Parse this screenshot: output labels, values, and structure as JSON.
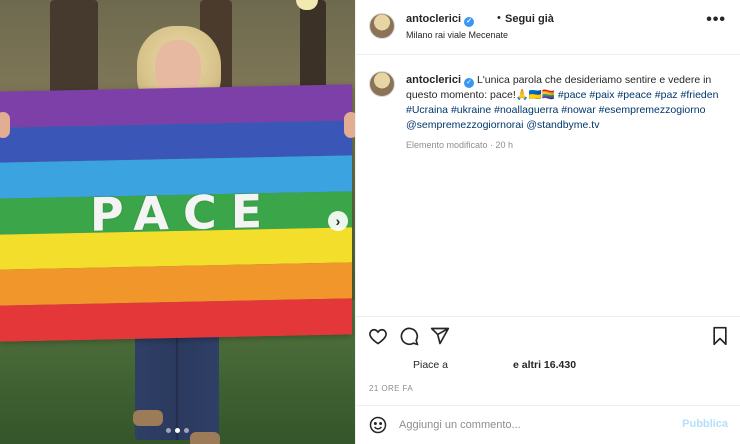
{
  "post": {
    "username": "antoclerici",
    "verified_glyph": "✓",
    "follow_separator": "•",
    "follow_label": "Segui già",
    "location": "Milano rai viale Mecenate",
    "more_glyph": "•••"
  },
  "media": {
    "flag_text": "PACE",
    "flag_colors": [
      "#7d3fa8",
      "#3a57b8",
      "#3aa3e0",
      "#3ba54a",
      "#f3df2b",
      "#f0962a",
      "#e4373a"
    ],
    "next_glyph": "›",
    "carousel_dots": 3,
    "carousel_active": 1
  },
  "caption": {
    "username": "antoclerici",
    "text": "L'unica parola che desideriamo sentire e vedere in questo momento: pace!🙏🇺🇦🏳️‍🌈",
    "hashtags": "#pace #paix #peace #paz #frieden #Ucraina #ukraine #noallaguerra #nowar #esempremezzogiorno @sempremezzogiornorai @standbyme.tv",
    "meta": "Elemento modificato · 20 h"
  },
  "actions": {
    "icons": [
      "heart-icon",
      "comment-icon",
      "share-icon",
      "bookmark-icon"
    ],
    "likes_prefix": "Piace a",
    "likes_suffix": "e altri 16.430",
    "time_ago": "21 ORE FA"
  },
  "comment": {
    "placeholder": "Aggiungi un commento...",
    "publish_label": "Pubblica"
  },
  "colors": {
    "link": "#00376b",
    "verified": "#3897f0",
    "publish_disabled": "#b2dffc",
    "muted": "#8e8e8e"
  }
}
